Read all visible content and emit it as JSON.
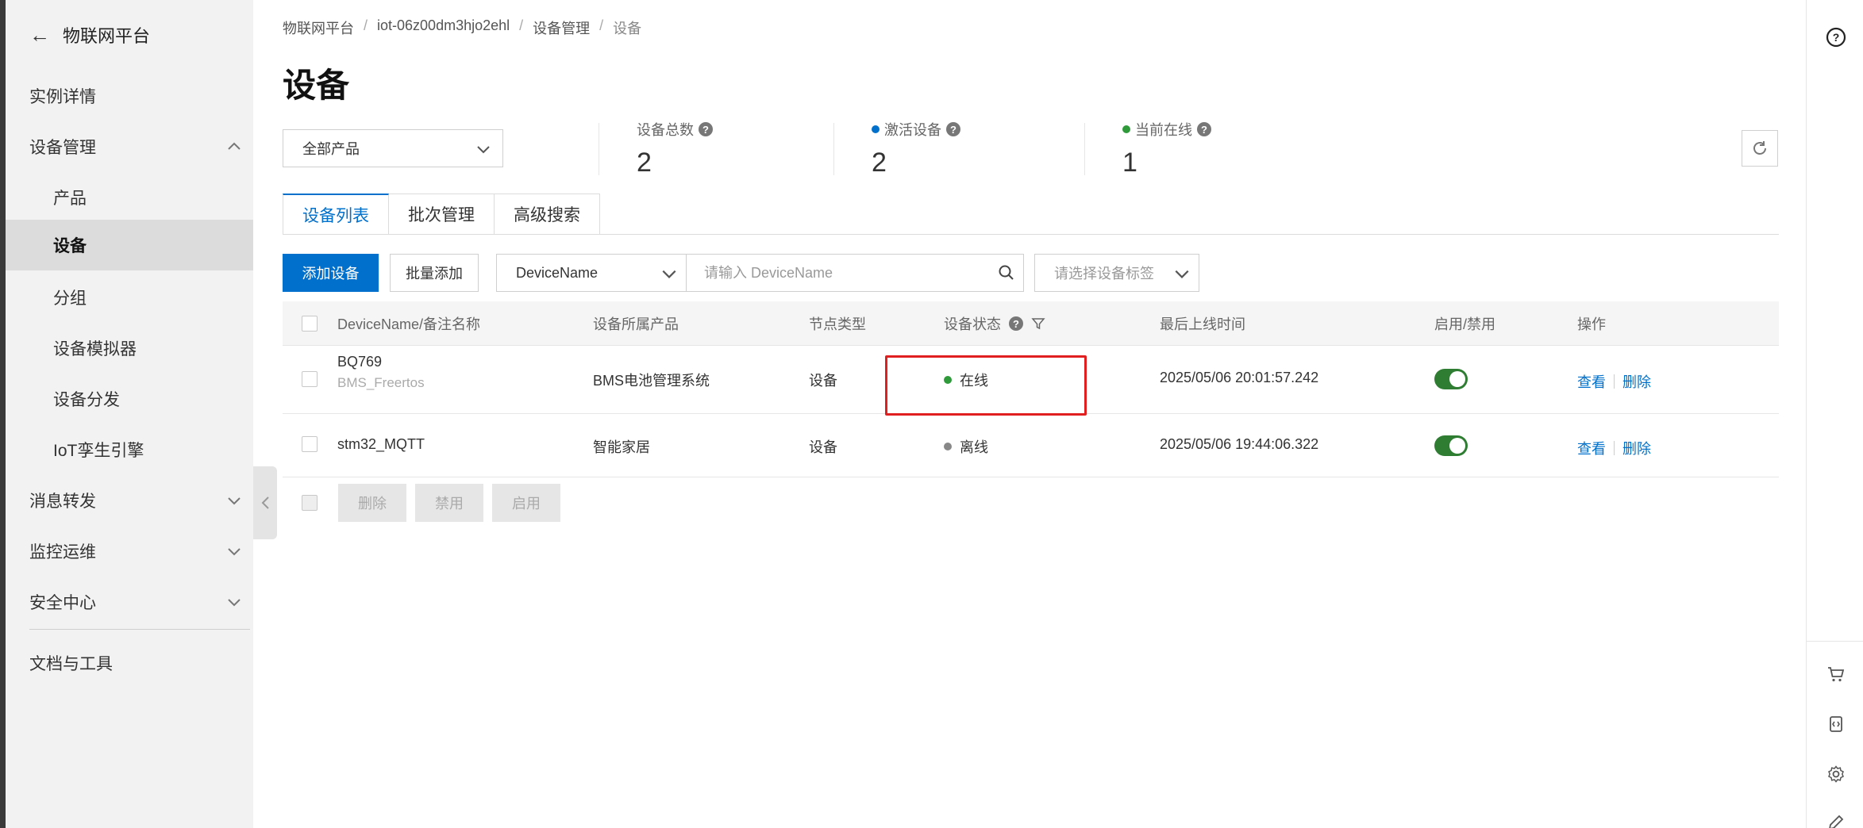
{
  "sidebar": {
    "title": "物联网平台",
    "items": [
      {
        "label": "实例详情"
      },
      {
        "label": "设备管理"
      },
      {
        "label": "产品"
      },
      {
        "label": "设备"
      },
      {
        "label": "分组"
      },
      {
        "label": "设备模拟器"
      },
      {
        "label": "设备分发"
      },
      {
        "label": "IoT孪生引擎"
      },
      {
        "label": "消息转发"
      },
      {
        "label": "监控运维"
      },
      {
        "label": "安全中心"
      },
      {
        "label": "文档与工具"
      }
    ]
  },
  "breadcrumb": [
    "物联网平台",
    "iot-06z00dm3hjo2ehl",
    "设备管理",
    "设备"
  ],
  "page": {
    "title": "设备"
  },
  "filters": {
    "product_select": "全部产品"
  },
  "stats": [
    {
      "label": "设备总数",
      "value": "2",
      "dot_color": ""
    },
    {
      "label": "激活设备",
      "value": "2",
      "dot_color": "#0070cc"
    },
    {
      "label": "当前在线",
      "value": "1",
      "dot_color": "#2e9a3a"
    }
  ],
  "tabs": [
    "设备列表",
    "批次管理",
    "高级搜索"
  ],
  "toolbar": {
    "add_label": "添加设备",
    "batch_add_label": "批量添加",
    "field_select": "DeviceName",
    "search_placeholder": "请输入 DeviceName",
    "tag_placeholder": "请选择设备标签"
  },
  "table": {
    "columns": [
      "DeviceName/备注名称",
      "设备所属产品",
      "节点类型",
      "设备状态",
      "最后上线时间",
      "启用/禁用",
      "操作"
    ],
    "rows": [
      {
        "name": "BQ769",
        "note": "BMS_Freertos",
        "product": "BMS电池管理系统",
        "node_type": "设备",
        "status": "在线",
        "status_color": "#2e9a3a",
        "last_online": "2025/05/06 20:01:57.242",
        "view": "查看",
        "delete": "删除"
      },
      {
        "name": "stm32_MQTT",
        "note": "",
        "product": "智能家居",
        "node_type": "设备",
        "status": "离线",
        "status_color": "#888888",
        "last_online": "2025/05/06 19:44:06.322",
        "view": "查看",
        "delete": "删除"
      }
    ]
  },
  "bulk_actions": [
    "删除",
    "禁用",
    "启用"
  ],
  "colors": {
    "primary": "#0070cc",
    "online": "#2e9a3a",
    "offline": "#888888",
    "highlight": "#e02020",
    "toggle_on": "#2e7d32"
  }
}
